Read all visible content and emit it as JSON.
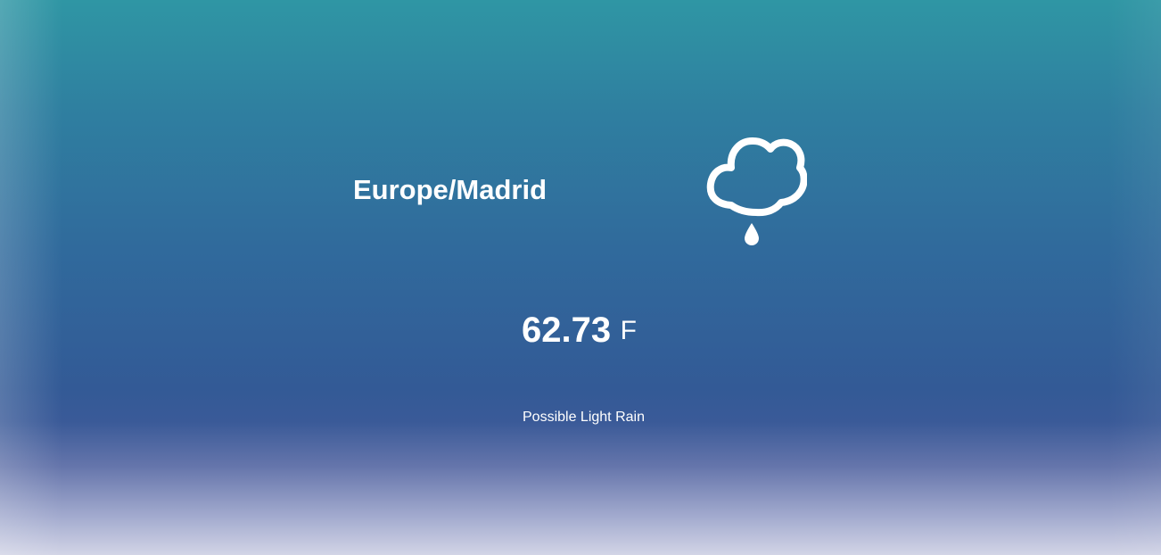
{
  "location": {
    "timezone": "Europe/Madrid"
  },
  "current": {
    "icon": "cloud-rain-drop-icon",
    "temperature": "62.73",
    "unit": "F",
    "summary": "Possible Light Rain"
  },
  "colors": {
    "text": "#ffffff",
    "gradient_top": "#2f96a4",
    "gradient_mid": "#335a96",
    "gradient_bottom": "#d2d4e6"
  }
}
